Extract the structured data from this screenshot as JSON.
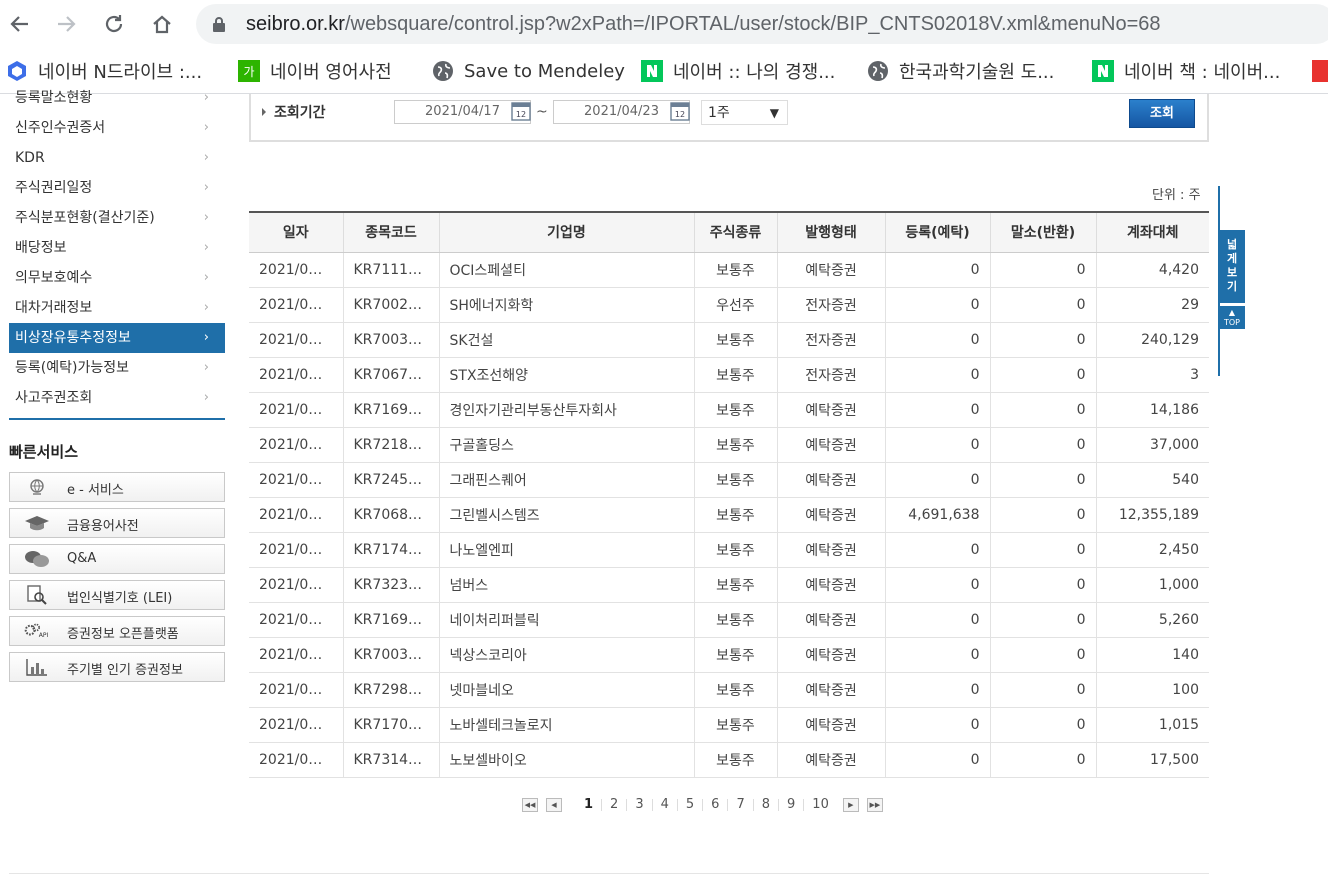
{
  "browser": {
    "url_host": "seibro.or.kr",
    "url_path": "/websquare/control.jsp?w2xPath=/IPORTAL/user/stock/BIP_CNTS02018V.xml&menuNo=68",
    "bookmarks": [
      {
        "label": "네이버 N드라이브 :...",
        "icon": "ndrive-icon",
        "color": "#3d6ee8"
      },
      {
        "label": "네이버 영어사전",
        "icon": "naver-dict-icon",
        "color": "#2db400"
      },
      {
        "label": "Save to Mendeley",
        "icon": "globe-icon",
        "color": "#5f6368"
      },
      {
        "label": "네이버 :: 나의 경쟁...",
        "icon": "naver-icon",
        "color": "#03c75a"
      },
      {
        "label": "한국과학기술원 도...",
        "icon": "globe-icon",
        "color": "#5f6368"
      },
      {
        "label": "네이버 책 : 네이버...",
        "icon": "naver-icon",
        "color": "#03c75a"
      }
    ]
  },
  "sidebar": {
    "items": [
      {
        "label": "등록말소현황"
      },
      {
        "label": "신주인수권증서"
      },
      {
        "label": "KDR"
      },
      {
        "label": "주식권리일정"
      },
      {
        "label": "주식분포현황(결산기준)"
      },
      {
        "label": "배당정보"
      },
      {
        "label": "의무보호예수"
      },
      {
        "label": "대차거래정보"
      },
      {
        "label": "비상장유통추정정보",
        "active": true
      },
      {
        "label": "등록(예탁)가능정보"
      },
      {
        "label": "사고주권조회"
      }
    ],
    "chevron": "›",
    "quick_title": "빠른서비스",
    "quick_items": [
      {
        "label": "e - 서비스",
        "icon": "globe-icon"
      },
      {
        "label": "금융용어사전",
        "icon": "graduation-cap-icon"
      },
      {
        "label": "Q&A",
        "icon": "chat-bubbles-icon"
      },
      {
        "label": "법인식별기호 (LEI)",
        "icon": "document-search-icon"
      },
      {
        "label": "증권정보 오픈플랫폼",
        "icon": "api-gear-icon"
      },
      {
        "label": "주기별 인기 증권정보",
        "icon": "bar-chart-icon"
      }
    ]
  },
  "search": {
    "label": "조회기간",
    "start_date": "2021/04/17",
    "end_date": "2021/04/23",
    "separator": "~",
    "period": "1주",
    "button": "조회"
  },
  "unit_label": "단위 : 주",
  "table": {
    "headers": [
      "일자",
      "종목코드",
      "기업명",
      "주식종류",
      "발행형태",
      "등록(예탁)",
      "말소(반환)",
      "계좌대체"
    ],
    "rows": [
      [
        "2021/0…",
        "KR7111…",
        "OCI스페셜티",
        "보통주",
        "예탁증권",
        "0",
        "0",
        "4,420"
      ],
      [
        "2021/0…",
        "KR7002…",
        "SH에너지화학",
        "우선주",
        "전자증권",
        "0",
        "0",
        "29"
      ],
      [
        "2021/0…",
        "KR7003…",
        "SK건설",
        "보통주",
        "전자증권",
        "0",
        "0",
        "240,129"
      ],
      [
        "2021/0…",
        "KR7067…",
        "STX조선해양",
        "보통주",
        "전자증권",
        "0",
        "0",
        "3"
      ],
      [
        "2021/0…",
        "KR7169…",
        "경인자기관리부동산투자회사",
        "보통주",
        "예탁증권",
        "0",
        "0",
        "14,186"
      ],
      [
        "2021/0…",
        "KR7218…",
        "구골홀딩스",
        "보통주",
        "예탁증권",
        "0",
        "0",
        "37,000"
      ],
      [
        "2021/0…",
        "KR7245…",
        "그래핀스퀘어",
        "보통주",
        "예탁증권",
        "0",
        "0",
        "540"
      ],
      [
        "2021/0…",
        "KR7068…",
        "그린벨시스템즈",
        "보통주",
        "예탁증권",
        "4,691,638",
        "0",
        "12,355,189"
      ],
      [
        "2021/0…",
        "KR7174…",
        "나노엘엔피",
        "보통주",
        "예탁증권",
        "0",
        "0",
        "2,450"
      ],
      [
        "2021/0…",
        "KR7323…",
        "넘버스",
        "보통주",
        "예탁증권",
        "0",
        "0",
        "1,000"
      ],
      [
        "2021/0…",
        "KR7169…",
        "네이처리퍼블릭",
        "보통주",
        "예탁증권",
        "0",
        "0",
        "5,260"
      ],
      [
        "2021/0…",
        "KR7003…",
        "넥상스코리아",
        "보통주",
        "예탁증권",
        "0",
        "0",
        "140"
      ],
      [
        "2021/0…",
        "KR7298…",
        "넷마블네오",
        "보통주",
        "예탁증권",
        "0",
        "0",
        "100"
      ],
      [
        "2021/0…",
        "KR7170…",
        "노바셀테크놀로지",
        "보통주",
        "예탁증권",
        "0",
        "0",
        "1,015"
      ],
      [
        "2021/0…",
        "KR7314…",
        "노보셀바이오",
        "보통주",
        "예탁증권",
        "0",
        "0",
        "17,500"
      ]
    ]
  },
  "float_tab": {
    "label": "넓게보기",
    "top_label": "TOP"
  },
  "pagination": {
    "current": "1",
    "pages": [
      "1",
      "2",
      "3",
      "4",
      "5",
      "6",
      "7",
      "8",
      "9",
      "10"
    ]
  },
  "colors": {
    "accent": "#1f6fa9",
    "button": "#1a63b3"
  }
}
